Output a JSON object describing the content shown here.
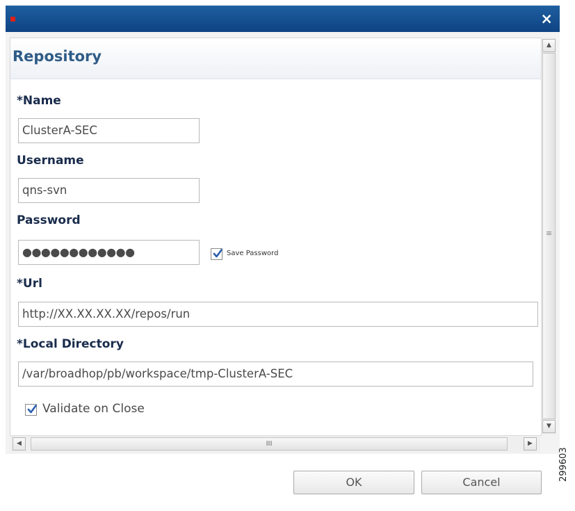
{
  "dialog": {
    "close_glyph": "×",
    "section_title": "Repository"
  },
  "form": {
    "name_label": "*Name",
    "name_value": "ClusterA-SEC",
    "username_label": "Username",
    "username_value": "qns-svn",
    "password_label": "Password",
    "password_value": "●●●●●●●●●●●●",
    "save_password_label": "Save Password",
    "save_password_checked": true,
    "url_label": "*Url",
    "url_value": "http://XX.XX.XX.XX/repos/run",
    "local_dir_label": "*Local Directory",
    "local_dir_value": "/var/broadhop/pb/workspace/tmp-ClusterA-SEC",
    "validate_label": "Validate on Close",
    "validate_checked": true
  },
  "scrollbar": {
    "up_glyph": "▲",
    "down_glyph": "▼",
    "left_glyph": "◀",
    "right_glyph": "▶",
    "vgrip_glyph": "≡",
    "hgrip_glyph": "III"
  },
  "buttons": {
    "ok_label": "OK",
    "cancel_label": "Cancel"
  },
  "figure_number": "299603",
  "colors": {
    "title_bar": "#1a5595",
    "section_title": "#2f5c87",
    "label": "#1a2c4c",
    "check": "#2a5fb0"
  }
}
